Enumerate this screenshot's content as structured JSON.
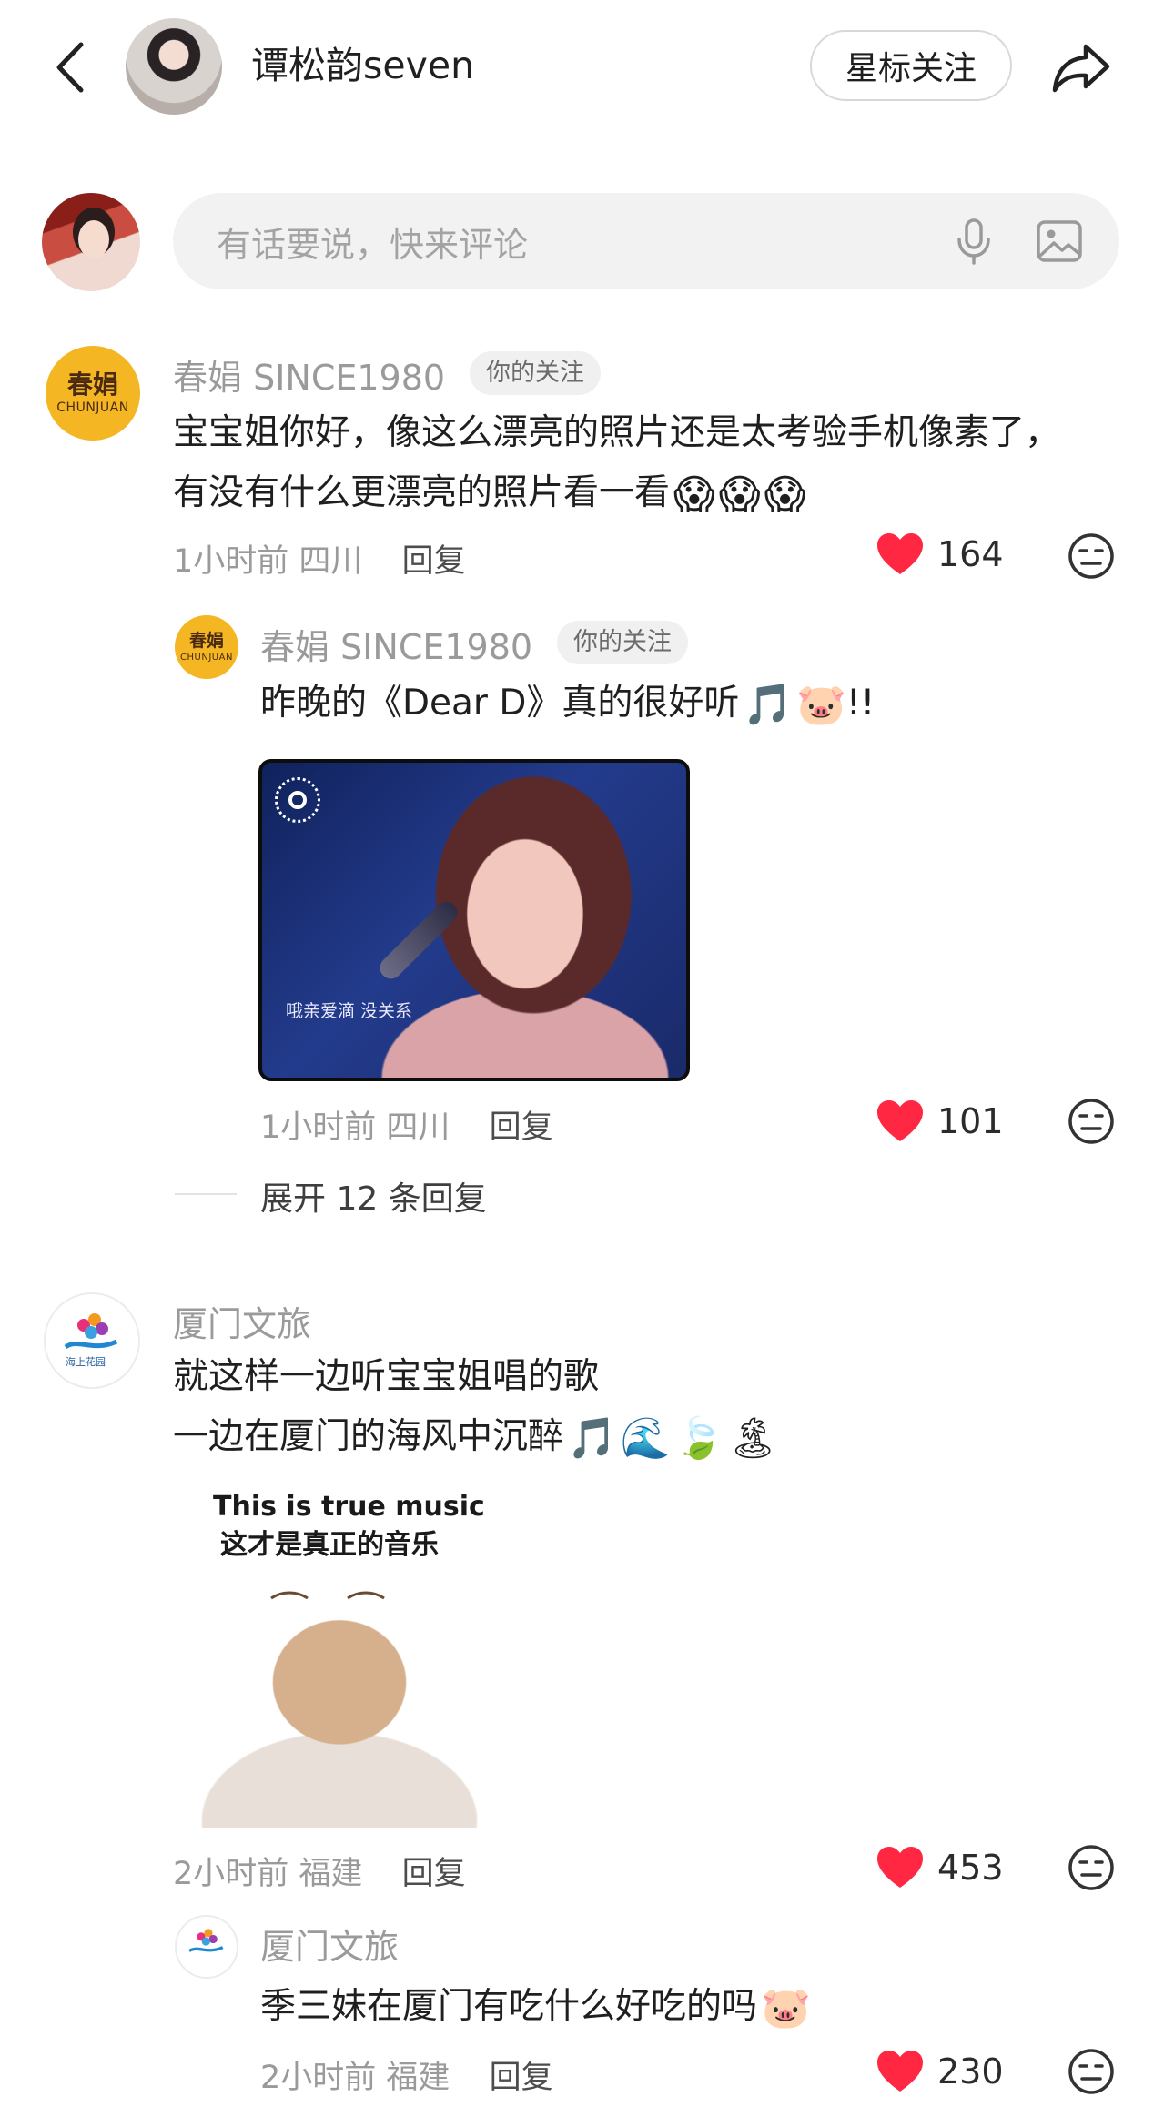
{
  "header": {
    "title": "谭松韵seven",
    "star_follow_label": "星标关注"
  },
  "comment_box": {
    "placeholder": "有话要说，快来评论"
  },
  "comments": [
    {
      "user": "春娟 SINCE1980",
      "tag": "你的关注",
      "avatar_text": {
        "cn": "春娟",
        "en": "CHUNJUAN"
      },
      "lines": [
        "宝宝姐你好，像这么漂亮的照片还是太考验手机像素了，",
        "有没有什么更漂亮的照片看一看"
      ],
      "emoji": [
        "😱",
        "😱",
        "😱"
      ],
      "time": "1小时前",
      "location": "四川",
      "reply_label": "回复",
      "likes": "164"
    },
    {
      "user": "春娟 SINCE1980",
      "tag": "你的关注",
      "avatar_text": {
        "cn": "春娟",
        "en": "CHUNJUAN"
      },
      "lines": [
        "昨晚的《Dear D》真的很好听"
      ],
      "emoji_suffix": "!!",
      "image_caption": "哦亲爱滴  没关系",
      "time": "1小时前",
      "location": "四川",
      "reply_label": "回复",
      "likes": "101"
    },
    {
      "user": "厦门文旅",
      "avatar_text": {
        "cn": "海上花园 浪漫厦门"
      },
      "lines": [
        "就这样一边听宝宝姐唱的歌",
        "一边在厦门的海风中沉醉"
      ],
      "sticker_caption_en": "This is true music",
      "sticker_caption_cn": "这才是真正的音乐",
      "time": "2小时前",
      "location": "福建",
      "reply_label": "回复",
      "likes": "453"
    },
    {
      "user": "厦门文旅",
      "lines": [
        "季三妹在厦门有吃什么好吃的吗"
      ],
      "time": "2小时前",
      "location": "福建",
      "reply_label": "回复",
      "likes": "230"
    }
  ],
  "expand_replies_label": "展开 12 条回复",
  "icons": {
    "back": "chevron-left-icon",
    "share": "share-arrow-icon",
    "mic": "microphone-icon",
    "image": "image-icon",
    "like": "heart-icon",
    "dislike": "neutral-face-icon"
  },
  "colors": {
    "like_red": "#ff2742",
    "follow_tag_bg": "#f0f0f0",
    "input_bg": "#f2f2f2"
  }
}
